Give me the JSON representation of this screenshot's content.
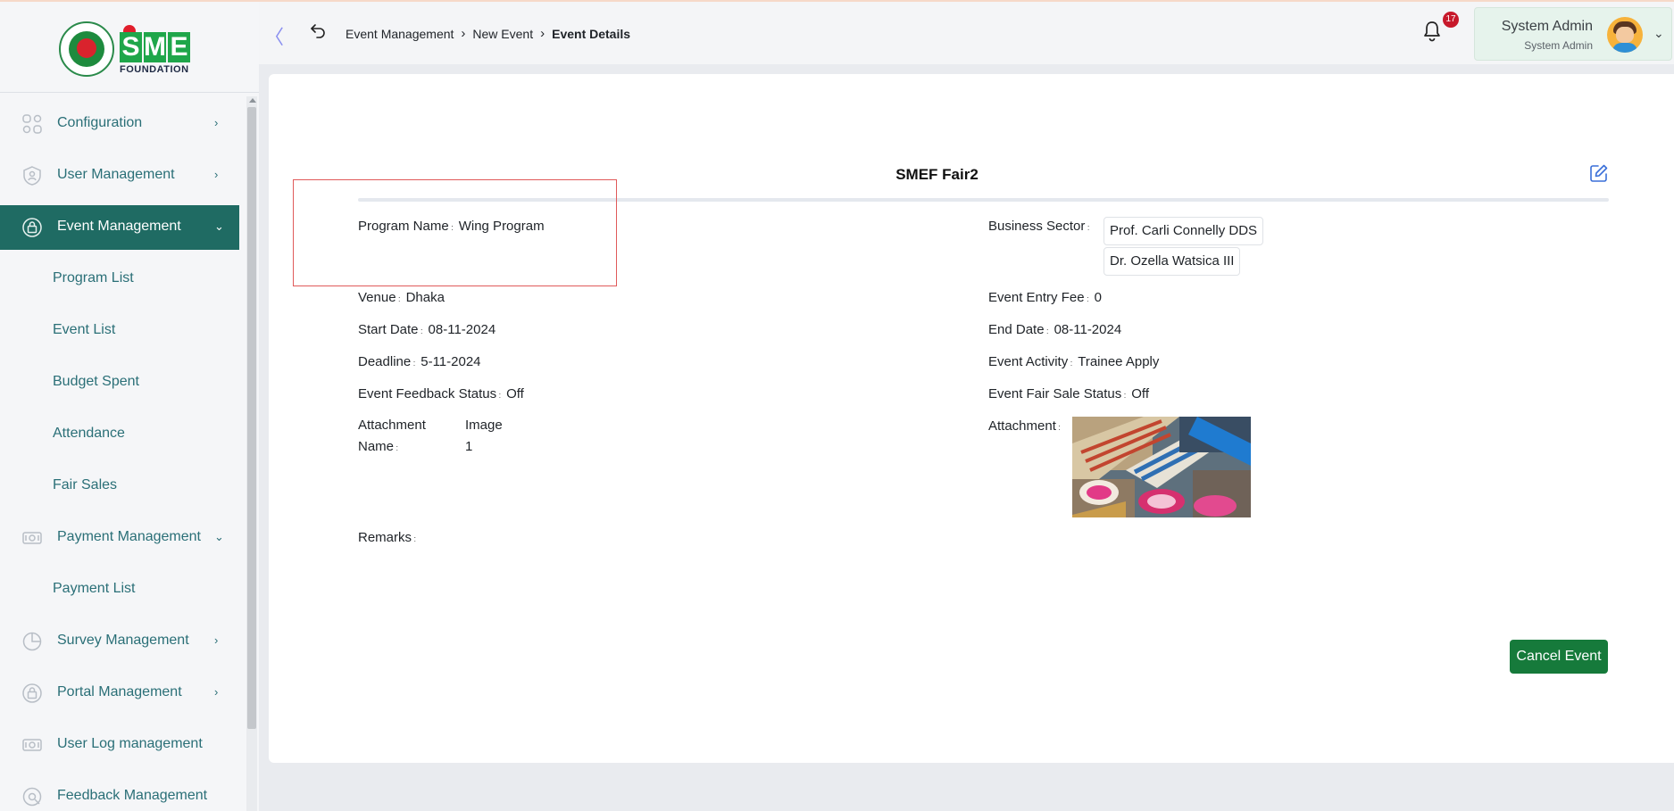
{
  "logo": {
    "brand_letters": [
      "S",
      "M",
      "E"
    ],
    "brand_sub": "FOUNDATION"
  },
  "sidebar": {
    "items": [
      {
        "label": "Configuration",
        "icon": "config-icon",
        "chevron": "›"
      },
      {
        "label": "User Management",
        "icon": "user-shield-icon",
        "chevron": "›"
      },
      {
        "label": "Event Management",
        "icon": "lock-icon",
        "chevron": "⌄",
        "active": true
      },
      {
        "label": "Program List"
      },
      {
        "label": "Event List"
      },
      {
        "label": "Budget Spent"
      },
      {
        "label": "Attendance"
      },
      {
        "label": "Fair Sales"
      },
      {
        "label": "Payment Management",
        "icon": "money-icon",
        "chevron": "⌄"
      },
      {
        "label": "Payment List"
      },
      {
        "label": "Survey Management",
        "icon": "pie-chart-icon",
        "chevron": "›"
      },
      {
        "label": "Portal Management",
        "icon": "lock-icon",
        "chevron": "›"
      },
      {
        "label": "User Log management",
        "icon": "money-icon"
      },
      {
        "label": "Feedback Management",
        "icon": "feedback-icon"
      }
    ]
  },
  "header": {
    "collapse_glyph": "〈",
    "breadcrumb": [
      "Event Management",
      "New Event",
      "Event Details"
    ],
    "breadcrumb_sep": "›",
    "notification_count": "17",
    "user_name": "System Admin",
    "user_role": "System Admin",
    "user_chevron": "⌄"
  },
  "event": {
    "title": "SMEF Fair2",
    "program_name_label": "Program Name",
    "program_name": "Wing Program",
    "business_sector_label": "Business Sector",
    "business_sectors": [
      "Prof. Carli Connelly DDS",
      "Dr. Ozella Watsica III"
    ],
    "venue_label": "Venue",
    "venue": "Dhaka",
    "entry_fee_label": "Event Entry Fee",
    "entry_fee": "0",
    "start_date_label": "Start Date",
    "start_date": "08-11-2024",
    "end_date_label": "End Date",
    "end_date": "08-11-2024",
    "deadline_label": "Deadline",
    "deadline": "5-11-2024",
    "activity_label": "Event Activity",
    "activity": "Trainee Apply",
    "feedback_status_label": "Event Feedback Status",
    "feedback_status": "Off",
    "fair_sale_status_label": "Event Fair Sale Status",
    "fair_sale_status": "Off",
    "attachment_name_label_1": "Attachment",
    "attachment_name_label_2": "Name",
    "attachment_name_1": "Image",
    "attachment_name_2": "1",
    "attachment_label": "Attachment",
    "remarks_label": "Remarks",
    "remarks": "",
    "cancel_button": "Cancel Event"
  },
  "colors": {
    "sidebar_active": "#1f6b63",
    "nav_text": "#2a6f77",
    "cancel_button": "#167a3b",
    "badge": "#c7192b",
    "highlight_border": "#e05a5a"
  }
}
